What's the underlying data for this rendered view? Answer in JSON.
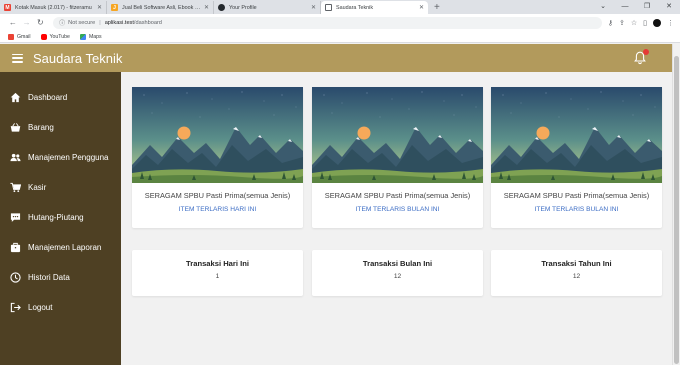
{
  "browser": {
    "tabs": [
      {
        "title": "Kotak Masuk (2.017) - fitzeramu",
        "favicon_color": "#ea4335",
        "favicon_glyph": "M",
        "active": false
      },
      {
        "title": "Jual Beli Software Asli, Ebook dan",
        "favicon_color": "#f6a623",
        "favicon_glyph": "J",
        "active": false
      },
      {
        "title": "Your Profile",
        "favicon_color": "#24292e",
        "favicon_glyph": "",
        "active": false
      },
      {
        "title": "Saudara Teknik",
        "favicon_color": "#5f6368",
        "favicon_glyph": "",
        "active": true
      }
    ],
    "new_tab_symbol": "+",
    "security_label": "Not secure",
    "url_host": "aplikasi.test",
    "url_path": "/dashboard",
    "bookmarks": [
      {
        "label": "Gmail",
        "color": "#ea4335"
      },
      {
        "label": "YouTube",
        "color": "#ff0000"
      },
      {
        "label": "Maps",
        "color": "#34a853"
      }
    ]
  },
  "app": {
    "brand": "Saudara Teknik",
    "colors": {
      "topbar": "#b29a5c",
      "sidebar": "#4e4023",
      "link": "#3b6cc4",
      "badge": "#e53935"
    },
    "notification_icon": "bell-icon",
    "sidebar": [
      {
        "label": "Dashboard",
        "icon": "home-icon"
      },
      {
        "label": "Barang",
        "icon": "basket-icon"
      },
      {
        "label": "Manajemen Pengguna",
        "icon": "users-icon"
      },
      {
        "label": "Kasir",
        "icon": "cart-icon"
      },
      {
        "label": "Hutang-Piutang",
        "icon": "comment-icon"
      },
      {
        "label": "Manajemen Laporan",
        "icon": "briefcase-icon"
      },
      {
        "label": "Histori Data",
        "icon": "clock-icon"
      },
      {
        "label": "Logout",
        "icon": "logout-icon"
      }
    ],
    "product_cards": [
      {
        "name": "SERAGAM SPBU Pasti Prima(semua Jenis)",
        "link": "ITEM TERLARIS HARI INI"
      },
      {
        "name": "SERAGAM SPBU Pasti Prima(semua Jenis)",
        "link": "ITEM TERLARIS BULAN INI"
      },
      {
        "name": "SERAGAM SPBU Pasti Prima(semua Jenis)",
        "link": "ITEM TERLARIS BULAN INI"
      }
    ],
    "stats": [
      {
        "title": "Transaksi Hari Ini",
        "value": "1"
      },
      {
        "title": "Transaksi Bulan Ini",
        "value": "12"
      },
      {
        "title": "Transaksi Tahun Ini",
        "value": "12"
      }
    ]
  }
}
